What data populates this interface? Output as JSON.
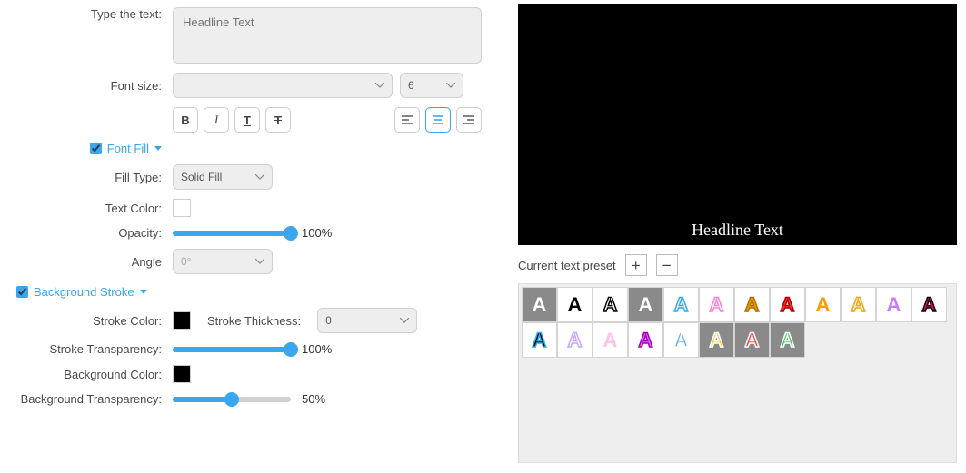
{
  "labels": {
    "type_text": "Type the text:",
    "font_size": "Font size:",
    "fill_type": "Fill Type:",
    "text_color": "Text Color:",
    "opacity": "Opacity:",
    "angle": "Angle",
    "stroke_color": "Stroke Color:",
    "stroke_thickness": "Stroke Thickness:",
    "stroke_transparency": "Stroke Transparency:",
    "background_color": "Background Color:",
    "background_transparency": "Background Transparency:"
  },
  "values": {
    "headline_placeholder": "Headline Text",
    "font_size_sub": "6",
    "fill_type": "Solid Fill",
    "text_color": "#ffffff",
    "opacity_pct": "100%",
    "angle": "0°",
    "stroke_color": "#000000",
    "stroke_thickness": "0",
    "stroke_transparency_pct": "100%",
    "background_color": "#000000",
    "background_transparency_pct": "50%"
  },
  "sections": {
    "font_fill": "Font Fill",
    "background_stroke": "Background Stroke"
  },
  "preview_text": "Headline Text",
  "preset_header": "Current text preset",
  "presets_row1": [
    {
      "bg": "#8a8a8a",
      "fill": "#ffffff",
      "stroke": "none"
    },
    {
      "bg": "#ffffff",
      "fill": "#000000",
      "stroke": "none"
    },
    {
      "bg": "#ffffff",
      "fill": "none",
      "stroke": "#000000"
    },
    {
      "bg": "#8a8a8a",
      "fill": "#ffffff",
      "stroke": "none"
    },
    {
      "bg": "#ffffff",
      "fill": "none",
      "stroke": "#39a7f0"
    },
    {
      "bg": "#ffffff",
      "fill": "none",
      "stroke": "#ff7fcf"
    },
    {
      "bg": "#ffffff",
      "fill": "#f4a300",
      "stroke": "#b06c00"
    },
    {
      "bg": "#ffffff",
      "fill": "#ff3333",
      "stroke": "#b00000"
    },
    {
      "bg": "#ffffff",
      "fill": "#ff9900",
      "stroke": "none"
    },
    {
      "bg": "#ffffff",
      "fill": "none",
      "stroke": "#f4a300"
    },
    {
      "bg": "#ffffff",
      "fill": "#c77dff",
      "stroke": "none"
    },
    {
      "bg": "#ffffff",
      "fill": "#ff0066",
      "stroke": "#000000"
    }
  ],
  "presets_row2": [
    {
      "bg": "#ffffff",
      "fill": "#000000",
      "stroke": "#39a7f0"
    },
    {
      "bg": "#ffffff",
      "fill": "#ffffff",
      "stroke": "#c9a7ff"
    },
    {
      "bg": "#ffffff",
      "fill": "#ffc2e6",
      "stroke": "none"
    },
    {
      "bg": "#ffffff",
      "fill": "#ff66b3",
      "stroke": "#9900cc"
    },
    {
      "bg": "#ffffff",
      "fill": "#5aa9ff",
      "stroke": "#ffffff"
    },
    {
      "bg": "#8a8a8a",
      "fill": "#ffd24d",
      "stroke": "#ffffff"
    },
    {
      "bg": "#8a8a8a",
      "fill": "#ff3333",
      "stroke": "#ffffff"
    },
    {
      "bg": "#8a8a8a",
      "fill": "#3fcf5f",
      "stroke": "#ffffff"
    }
  ]
}
